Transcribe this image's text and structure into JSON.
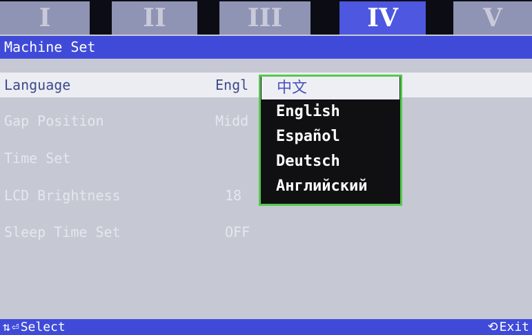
{
  "tabs": [
    {
      "label": "I",
      "active": false
    },
    {
      "label": "II",
      "active": false
    },
    {
      "label": "III",
      "active": false
    },
    {
      "label": "IV",
      "active": true
    },
    {
      "label": "V",
      "active": false
    }
  ],
  "header": {
    "title": "Machine Set"
  },
  "settings": [
    {
      "label": "Language",
      "value": "Engl"
    },
    {
      "label": "Gap Position",
      "value": "Midd"
    },
    {
      "label": "Time Set",
      "value": ""
    },
    {
      "label": "LCD Brightness",
      "value": "18"
    },
    {
      "label": "Sleep Time Set",
      "value": "OFF"
    }
  ],
  "language_dropdown": {
    "options": [
      "中文",
      "English",
      "Español",
      "Deutsch",
      "Английский"
    ],
    "selected": "中文"
  },
  "status": {
    "select_label": "Select",
    "exit_label": "Exit",
    "select_icons": [
      "up-down-arrows-icon",
      "enter-icon"
    ],
    "exit_icon": "rotate-icon"
  },
  "colors": {
    "accent_blue": "#3f4bd8",
    "tab_active": "#4d57e0",
    "tab_inactive": "#8f93b4",
    "dropdown_border": "#55c94b"
  }
}
